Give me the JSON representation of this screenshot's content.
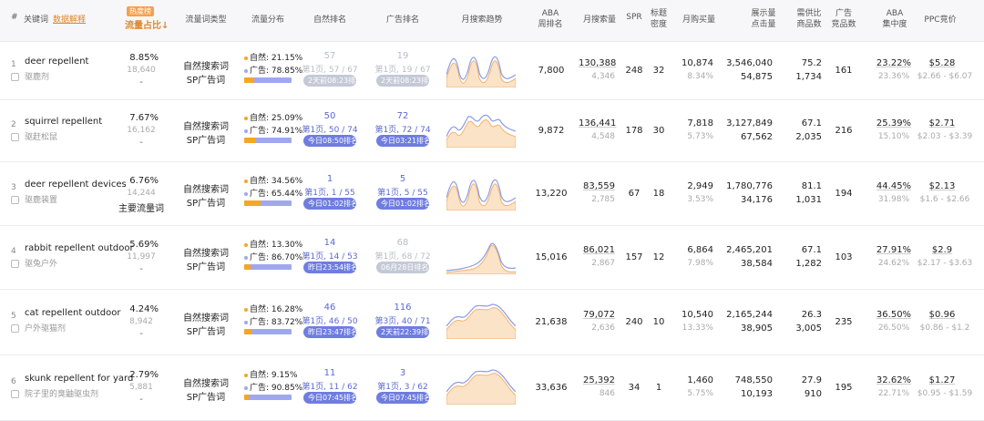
{
  "header": {
    "index": "#",
    "keyword": "关键词",
    "data_explain": "数据解释",
    "hot_badge": "热度榜",
    "traffic_share": "流量占比↓",
    "traffic_type": "流量词类型",
    "traffic_dist": "流量分布",
    "organic_rank": "自然排名",
    "ad_rank": "广告排名",
    "monthly_trend": "月搜索趋势",
    "aba_rank": [
      "ABA",
      "周排名"
    ],
    "monthly_search": "月搜索量",
    "spr": "SPR",
    "title_density": [
      "标题",
      "密度"
    ],
    "monthly_purchase": "月购买量",
    "impressions_clicks": [
      "展示量",
      "点击量"
    ],
    "supply_demand": [
      "需供比",
      "商品数"
    ],
    "ad_products": [
      "广告",
      "竞品数"
    ],
    "aba_concentration": [
      "ABA",
      "集中度"
    ],
    "ppc": "PPC竞价"
  },
  "rows": [
    {
      "index": "1",
      "keyword": "deer repellent",
      "keyword_cn": "驱鹿剂",
      "share": "8.85%",
      "share_sub": "18,640",
      "share_tag": "-",
      "type1": "自然搜索词",
      "type2": "SP广告词",
      "organic_label": "自然:",
      "organic_pct": "21.15%",
      "ad_label": "广告:",
      "ad_pct": "78.85%",
      "organic_fraction": 0.2115,
      "org_rank": "57",
      "org_page": "第1页, 57 / 67",
      "org_pill": "2天前08:23排名",
      "org_faded": true,
      "ad_rank": "19",
      "ad_page": "第1页, 19 / 67",
      "ad_pill": "2天前08:23排名",
      "ad_faded": true,
      "trend_shape": "double-peak",
      "aba": "7,800",
      "search": "130,388",
      "search_sub": "4,346",
      "spr": "248",
      "density": "32",
      "purchase": "10,874",
      "purchase_sub": "8.34%",
      "impr": "3,546,040",
      "clicks": "54,875",
      "sd": "75.2",
      "products": "1,734",
      "ads": "161",
      "conc": "23.22%",
      "conc_sub": "23.36%",
      "ppc": "$5.28",
      "ppc_sub": "$2.66 - $6.07"
    },
    {
      "index": "2",
      "keyword": "squirrel repellent",
      "keyword_cn": "驱赶松鼠",
      "share": "7.67%",
      "share_sub": "16,162",
      "share_tag": "-",
      "type1": "自然搜索词",
      "type2": "SP广告词",
      "organic_label": "自然:",
      "organic_pct": "25.09%",
      "ad_label": "广告:",
      "ad_pct": "74.91%",
      "organic_fraction": 0.2509,
      "org_rank": "50",
      "org_page": "第1页, 50 / 74",
      "org_pill": "今日08:50排名",
      "org_faded": false,
      "ad_rank": "72",
      "ad_page": "第1页, 72 / 74",
      "ad_pill": "今日03:21排名",
      "ad_faded": false,
      "trend_shape": "multi-peak",
      "aba": "9,872",
      "search": "136,441",
      "search_sub": "4,548",
      "spr": "178",
      "density": "30",
      "purchase": "7,818",
      "purchase_sub": "5.73%",
      "impr": "3,127,849",
      "clicks": "67,562",
      "sd": "67.1",
      "products": "2,035",
      "ads": "216",
      "conc": "25.39%",
      "conc_sub": "15.10%",
      "ppc": "$2.71",
      "ppc_sub": "$2.03 - $3.39"
    },
    {
      "index": "3",
      "keyword": "deer repellent devices",
      "keyword_cn": "驱鹿装置",
      "share": "6.76%",
      "share_sub": "14,244",
      "share_tag": "主要流量词",
      "type1": "自然搜索词",
      "type2": "SP广告词",
      "organic_label": "自然:",
      "organic_pct": "34.56%",
      "ad_label": "广告:",
      "ad_pct": "65.44%",
      "organic_fraction": 0.3456,
      "org_rank": "1",
      "org_page": "第1页, 1 / 55",
      "org_pill": "今日01:02排名",
      "org_faded": false,
      "ad_rank": "5",
      "ad_page": "第1页, 5 / 55",
      "ad_pill": "今日01:02排名",
      "ad_faded": false,
      "trend_shape": "double-peak",
      "aba": "13,220",
      "search": "83,559",
      "search_sub": "2,785",
      "spr": "67",
      "density": "18",
      "purchase": "2,949",
      "purchase_sub": "3.53%",
      "impr": "1,780,776",
      "clicks": "34,176",
      "sd": "81.1",
      "products": "1,031",
      "ads": "194",
      "conc": "44.45%",
      "conc_sub": "31.98%",
      "ppc": "$2.13",
      "ppc_sub": "$1.6 - $2.66"
    },
    {
      "index": "4",
      "keyword": "rabbit repellent outdoor",
      "keyword_cn": "驱兔户外",
      "share": "5.69%",
      "share_sub": "11,997",
      "share_tag": "-",
      "type1": "自然搜索词",
      "type2": "SP广告词",
      "organic_label": "自然:",
      "organic_pct": "13.30%",
      "ad_label": "广告:",
      "ad_pct": "86.70%",
      "organic_fraction": 0.133,
      "org_rank": "14",
      "org_page": "第1页, 14 / 53",
      "org_pill": "昨日23:54排名",
      "org_faded": false,
      "ad_rank": "68",
      "ad_page": "第1页, 68 / 72",
      "ad_pill": "06月28日排名",
      "ad_faded": true,
      "trend_shape": "late-peak",
      "aba": "15,016",
      "search": "86,021",
      "search_sub": "2,867",
      "spr": "157",
      "density": "12",
      "purchase": "6,864",
      "purchase_sub": "7.98%",
      "impr": "2,465,201",
      "clicks": "38,584",
      "sd": "67.1",
      "products": "1,282",
      "ads": "103",
      "conc": "27.91%",
      "conc_sub": "24.62%",
      "ppc": "$2.9",
      "ppc_sub": "$2.17 - $3.63"
    },
    {
      "index": "5",
      "keyword": "cat repellent outdoor",
      "keyword_cn": "户外驱猫剂",
      "share": "4.24%",
      "share_sub": "8,942",
      "share_tag": "-",
      "type1": "自然搜索词",
      "type2": "SP广告词",
      "organic_label": "自然:",
      "organic_pct": "16.28%",
      "ad_label": "广告:",
      "ad_pct": "83.72%",
      "organic_fraction": 0.1628,
      "org_rank": "46",
      "org_page": "第1页, 46 / 50",
      "org_pill": "昨日23:47排名",
      "org_faded": false,
      "ad_rank": "116",
      "ad_page": "第3页, 40 / 71",
      "ad_pill": "2天前22:39排名",
      "ad_faded": false,
      "trend_shape": "plateau",
      "aba": "21,638",
      "search": "79,072",
      "search_sub": "2,636",
      "spr": "240",
      "density": "10",
      "purchase": "10,540",
      "purchase_sub": "13.33%",
      "impr": "2,165,244",
      "clicks": "38,905",
      "sd": "26.3",
      "products": "3,005",
      "ads": "235",
      "conc": "36.50%",
      "conc_sub": "26.50%",
      "ppc": "$0.96",
      "ppc_sub": "$0.86 - $1.2"
    },
    {
      "index": "6",
      "keyword": "skunk repellent for yard",
      "keyword_cn": "院子里的臭鼬驱虫剂",
      "share": "2.79%",
      "share_sub": "5,881",
      "share_tag": "-",
      "type1": "自然搜索词",
      "type2": "SP广告词",
      "organic_label": "自然:",
      "organic_pct": "9.15%",
      "ad_label": "广告:",
      "ad_pct": "90.85%",
      "organic_fraction": 0.0915,
      "org_rank": "11",
      "org_page": "第1页, 11 / 62",
      "org_pill": "今日07:45排名",
      "org_faded": false,
      "ad_rank": "3",
      "ad_page": "第1页, 3 / 62",
      "ad_pill": "今日07:45排名",
      "ad_faded": false,
      "trend_shape": "plateau",
      "aba": "33,636",
      "search": "25,392",
      "search_sub": "846",
      "spr": "34",
      "density": "1",
      "purchase": "1,460",
      "purchase_sub": "5.75%",
      "impr": "748,550",
      "clicks": "10,193",
      "sd": "27.9",
      "products": "910",
      "ads": "195",
      "conc": "32.62%",
      "conc_sub": "22.71%",
      "ppc": "$1.27",
      "ppc_sub": "$0.95 - $1.59"
    }
  ],
  "colors": {
    "accent": "#e0862b",
    "rank_blue": "#5b6ad0",
    "organic_bar": "#f5a623",
    "ad_bar": "#9fa8ee"
  }
}
